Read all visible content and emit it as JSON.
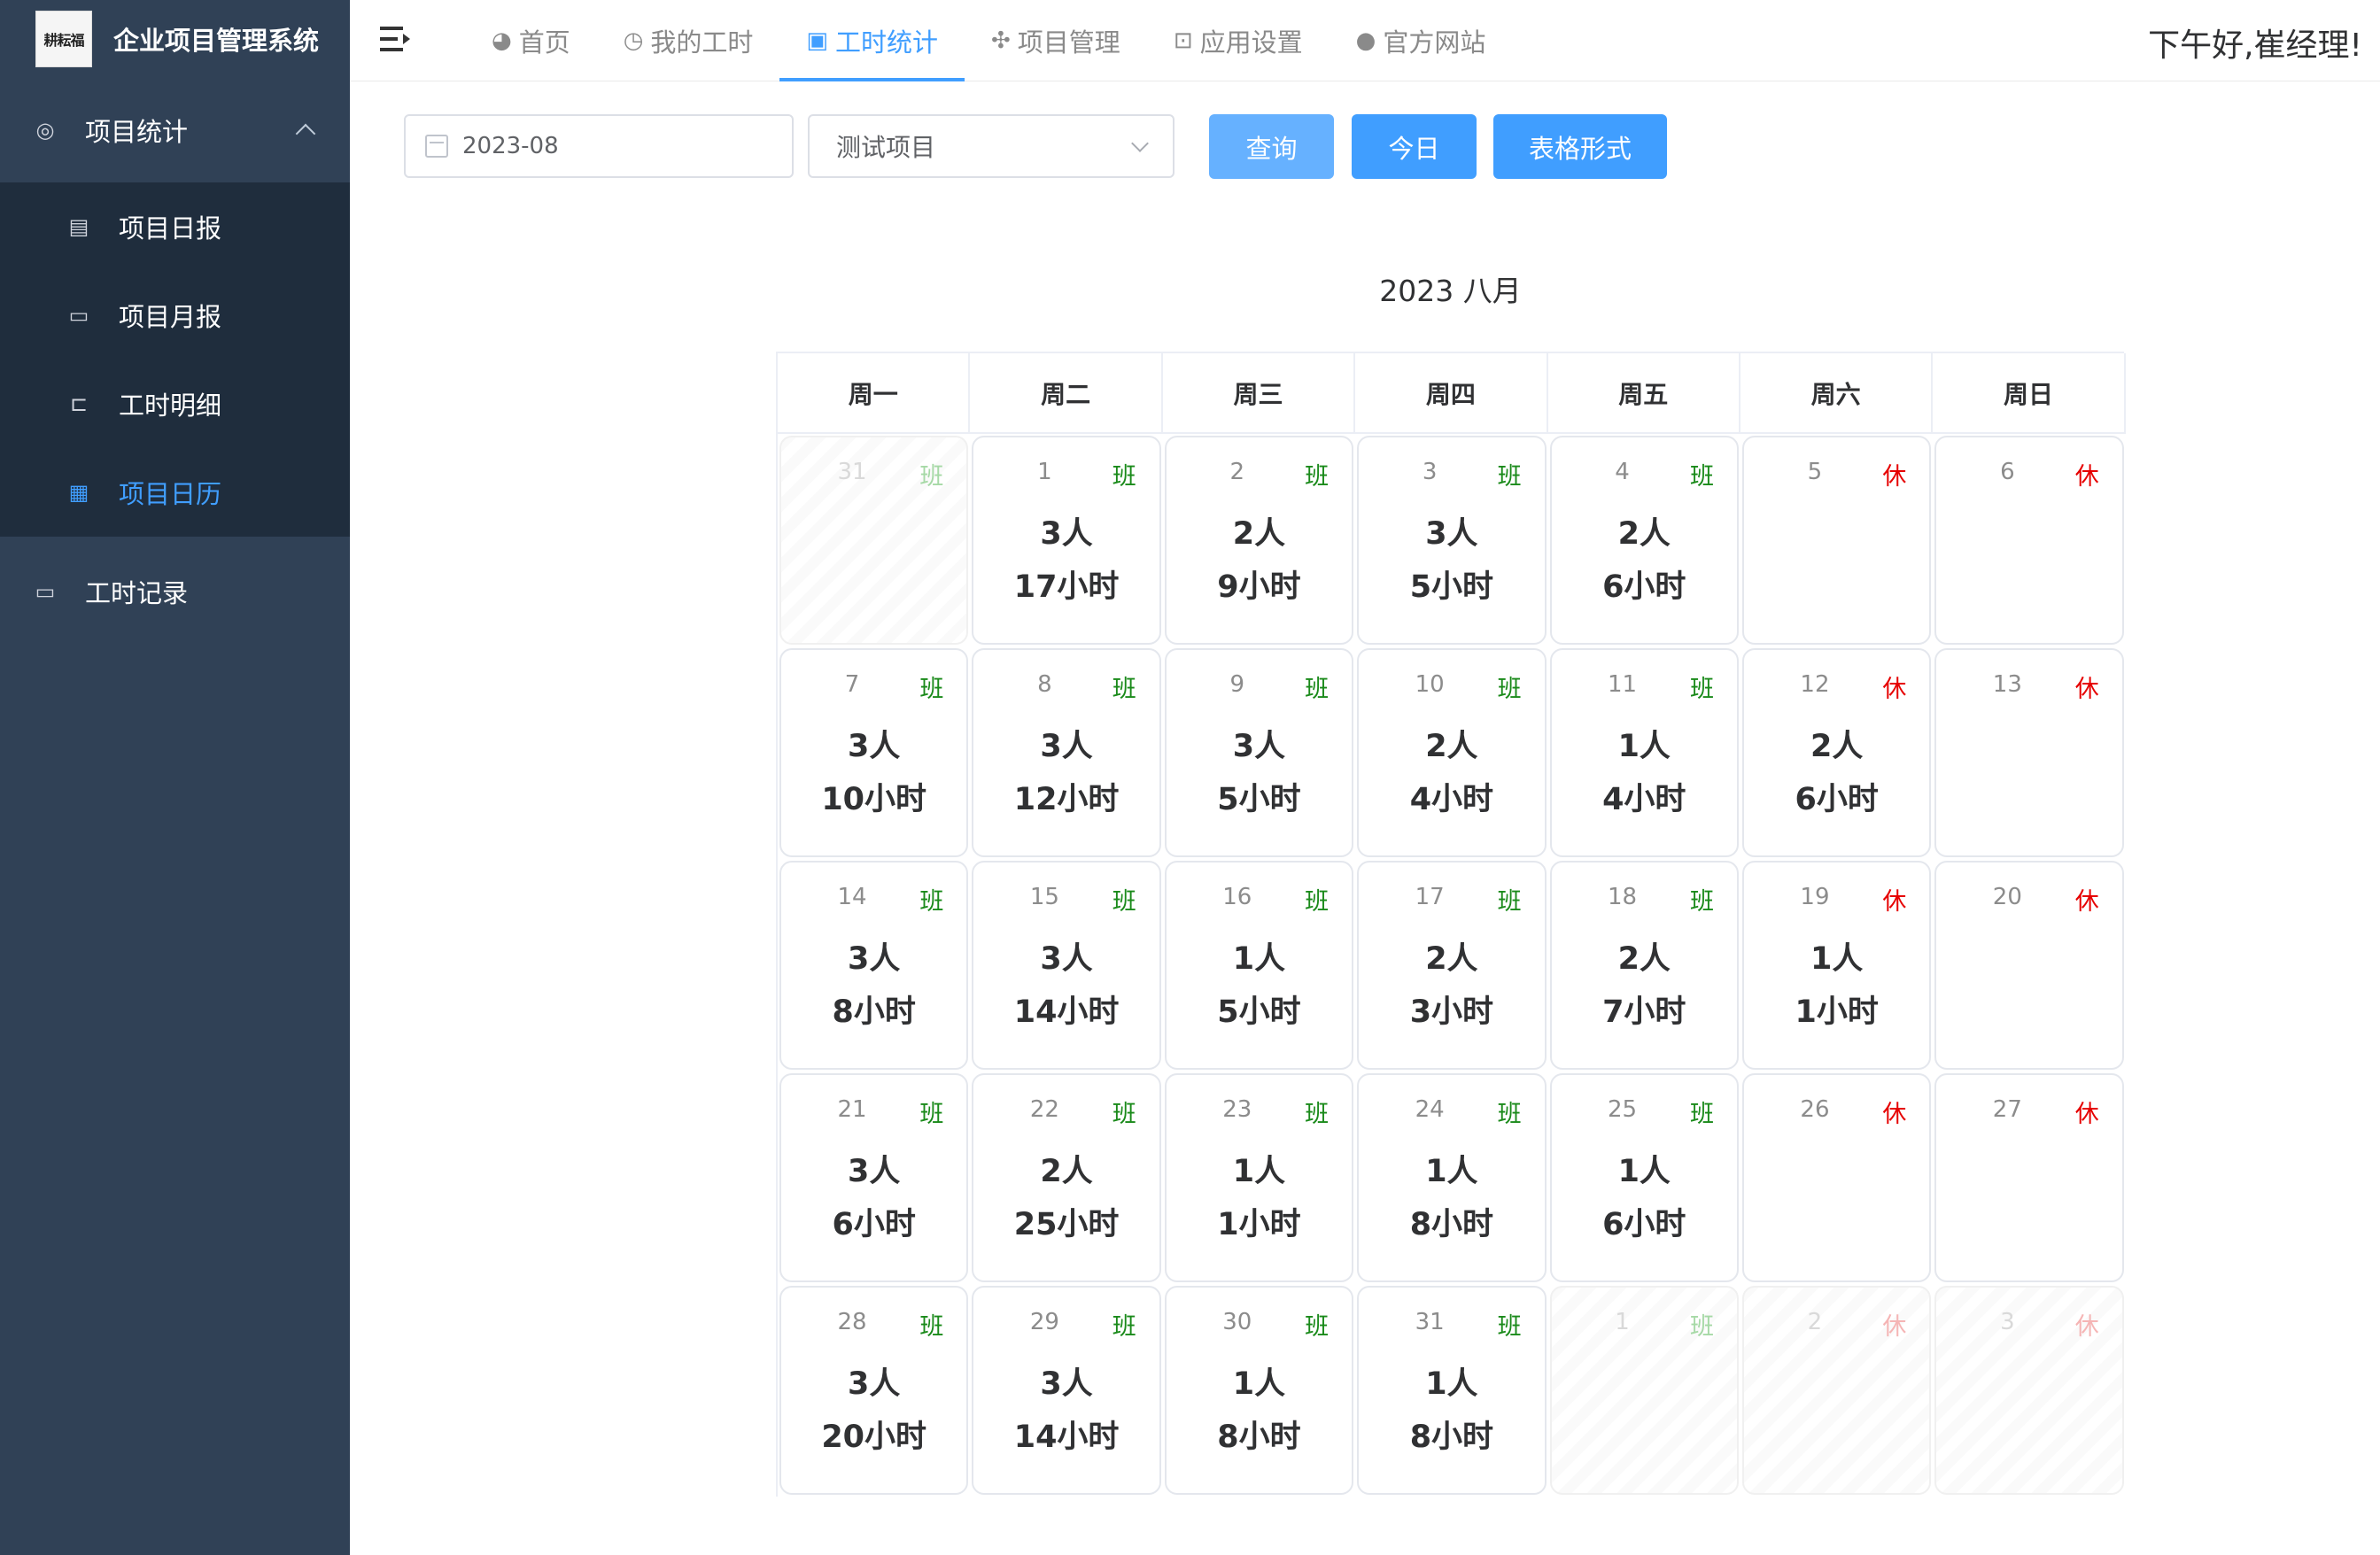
{
  "app": {
    "title": "企业项目管理系统",
    "logo_text": "耕耘福"
  },
  "sidebar": {
    "group_label": "项目统计",
    "items": [
      {
        "label": "项目日报",
        "icon": "document-icon"
      },
      {
        "label": "项目月报",
        "icon": "monitor-icon"
      },
      {
        "label": "工时明细",
        "icon": "tree-icon"
      },
      {
        "label": "项目日历",
        "icon": "calendar-icon"
      }
    ],
    "bottom_label": "工时记录"
  },
  "nav": {
    "tabs": [
      {
        "label": "首页",
        "icon": "dashboard-icon"
      },
      {
        "label": "我的工时",
        "icon": "clock-icon"
      },
      {
        "label": "工时统计",
        "icon": "chart-icon"
      },
      {
        "label": "项目管理",
        "icon": "puzzle-icon"
      },
      {
        "label": "应用设置",
        "icon": "settings-icon"
      },
      {
        "label": "官方网站",
        "icon": "globe-icon"
      }
    ],
    "active_tab": "工时统计",
    "greeting": "下午好,崔经理!"
  },
  "filters": {
    "month": "2023-08",
    "project": "测试项目",
    "query_label": "查询",
    "today_label": "今日",
    "table_label": "表格形式"
  },
  "colors": {
    "accent": "#409eff",
    "work": "#1a8a1a",
    "rest": "#e60000",
    "sidebar": "#304156"
  },
  "calendar": {
    "title": "2023 八月",
    "weekdays": [
      "周一",
      "周二",
      "周三",
      "周四",
      "周五",
      "周六",
      "周日"
    ],
    "days": [
      {
        "d": "31",
        "tag": "班",
        "other": true
      },
      {
        "d": "1",
        "tag": "班",
        "people": "3人",
        "hours": "17小时"
      },
      {
        "d": "2",
        "tag": "班",
        "people": "2人",
        "hours": "9小时"
      },
      {
        "d": "3",
        "tag": "班",
        "people": "3人",
        "hours": "5小时"
      },
      {
        "d": "4",
        "tag": "班",
        "people": "2人",
        "hours": "6小时"
      },
      {
        "d": "5",
        "tag": "休"
      },
      {
        "d": "6",
        "tag": "休"
      },
      {
        "d": "7",
        "tag": "班",
        "people": "3人",
        "hours": "10小时"
      },
      {
        "d": "8",
        "tag": "班",
        "people": "3人",
        "hours": "12小时"
      },
      {
        "d": "9",
        "tag": "班",
        "people": "3人",
        "hours": "5小时"
      },
      {
        "d": "10",
        "tag": "班",
        "people": "2人",
        "hours": "4小时"
      },
      {
        "d": "11",
        "tag": "班",
        "people": "1人",
        "hours": "4小时"
      },
      {
        "d": "12",
        "tag": "休",
        "people": "2人",
        "hours": "6小时"
      },
      {
        "d": "13",
        "tag": "休"
      },
      {
        "d": "14",
        "tag": "班",
        "people": "3人",
        "hours": "8小时"
      },
      {
        "d": "15",
        "tag": "班",
        "people": "3人",
        "hours": "14小时"
      },
      {
        "d": "16",
        "tag": "班",
        "people": "1人",
        "hours": "5小时"
      },
      {
        "d": "17",
        "tag": "班",
        "people": "2人",
        "hours": "3小时"
      },
      {
        "d": "18",
        "tag": "班",
        "people": "2人",
        "hours": "7小时"
      },
      {
        "d": "19",
        "tag": "休",
        "people": "1人",
        "hours": "1小时"
      },
      {
        "d": "20",
        "tag": "休"
      },
      {
        "d": "21",
        "tag": "班",
        "people": "3人",
        "hours": "6小时"
      },
      {
        "d": "22",
        "tag": "班",
        "people": "2人",
        "hours": "25小时"
      },
      {
        "d": "23",
        "tag": "班",
        "people": "1人",
        "hours": "1小时"
      },
      {
        "d": "24",
        "tag": "班",
        "people": "1人",
        "hours": "8小时"
      },
      {
        "d": "25",
        "tag": "班",
        "people": "1人",
        "hours": "6小时"
      },
      {
        "d": "26",
        "tag": "休"
      },
      {
        "d": "27",
        "tag": "休"
      },
      {
        "d": "28",
        "tag": "班",
        "people": "3人",
        "hours": "20小时"
      },
      {
        "d": "29",
        "tag": "班",
        "people": "3人",
        "hours": "14小时"
      },
      {
        "d": "30",
        "tag": "班",
        "people": "1人",
        "hours": "8小时"
      },
      {
        "d": "31",
        "tag": "班",
        "people": "1人",
        "hours": "8小时"
      },
      {
        "d": "1",
        "tag": "班",
        "other": true
      },
      {
        "d": "2",
        "tag": "休",
        "other": true
      },
      {
        "d": "3",
        "tag": "休",
        "other": true
      }
    ]
  }
}
